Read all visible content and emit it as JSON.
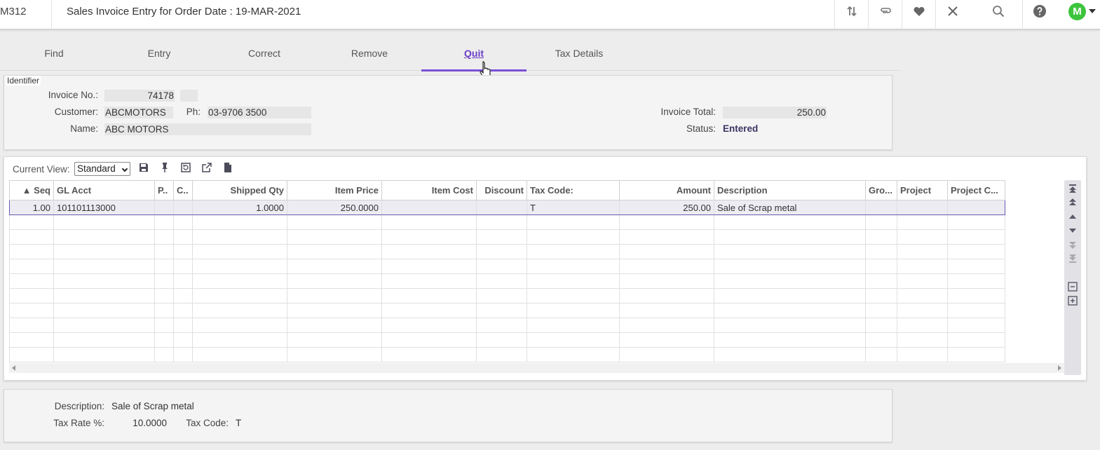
{
  "header": {
    "code": "M312",
    "title": "Sales Invoice Entry for Order Date : 19-MAR-2021",
    "avatar_letter": "M",
    "icons": [
      "sort-icon",
      "attachment-icon",
      "favorite-icon",
      "close-icon",
      "search-icon",
      "help-icon"
    ]
  },
  "tabs": [
    {
      "label": "Find",
      "active": false
    },
    {
      "label": "Entry",
      "active": false
    },
    {
      "label": "Correct",
      "active": false
    },
    {
      "label": "Remove",
      "active": false
    },
    {
      "label": "Quit",
      "active": true
    },
    {
      "label": "Tax Details",
      "active": false
    }
  ],
  "identifier": {
    "legend": "Identifier",
    "invoice_no_label": "Invoice No.:",
    "invoice_no": "74178",
    "customer_label": "Customer:",
    "customer": "ABCMOTORS",
    "phone_label": "Ph:",
    "phone": "03-9706 3500",
    "name_label": "Name:",
    "name": "ABC MOTORS",
    "invoice_total_label": "Invoice Total:",
    "invoice_total": "250.00",
    "status_label": "Status:",
    "status": "Entered"
  },
  "grid": {
    "current_view_label": "Current View:",
    "current_view": "Standard",
    "columns": [
      "▲ Seq",
      "GL Acct",
      "P..",
      "C..",
      "Shipped Qty",
      "Item Price",
      "Item Cost",
      "Discount",
      "Tax Code:",
      "Amount",
      "Description",
      "Gro...",
      "Project",
      "Project C..."
    ],
    "rows": [
      [
        "1.00",
        "101101113000",
        "",
        "",
        "1.0000",
        "250.0000",
        "",
        "",
        "T",
        "250.00",
        "Sale of Scrap metal",
        "",
        "",
        ""
      ]
    ]
  },
  "details": {
    "description_label": "Description:",
    "description": "Sale of Scrap metal",
    "tax_rate_label": "Tax Rate %:",
    "tax_rate": "10.0000",
    "tax_code_label": "Tax Code:",
    "tax_code": "T"
  },
  "colors": {
    "accent": "#7b4fd6",
    "avatar": "#3cc43c",
    "status": "#3d3363"
  }
}
